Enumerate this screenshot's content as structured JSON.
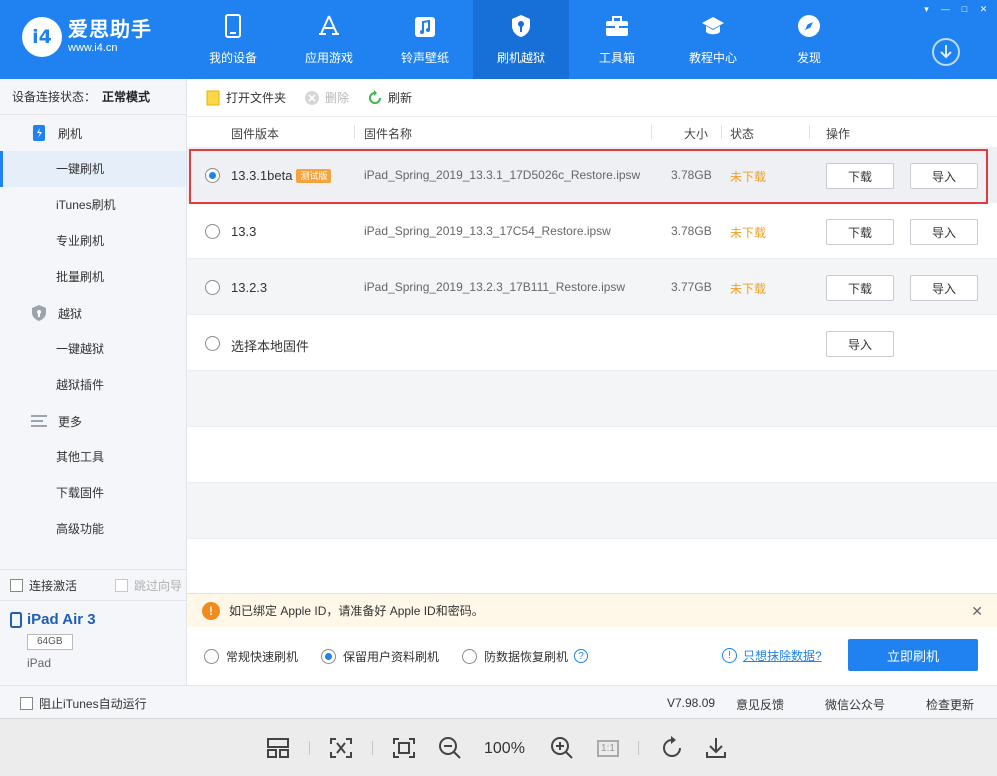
{
  "window_controls": [
    "▾",
    "—",
    "□",
    "✕"
  ],
  "logo": {
    "badge": "i4",
    "name": "爱思助手",
    "url": "www.i4.cn"
  },
  "nav": [
    {
      "label": "我的设备",
      "icon": "phone-icon"
    },
    {
      "label": "应用游戏",
      "icon": "app-store-icon"
    },
    {
      "label": "铃声壁纸",
      "icon": "music-note-icon"
    },
    {
      "label": "刷机越狱",
      "icon": "shield-key-icon",
      "active": true
    },
    {
      "label": "工具箱",
      "icon": "toolbox-icon"
    },
    {
      "label": "教程中心",
      "icon": "graduation-cap-icon"
    },
    {
      "label": "发现",
      "icon": "compass-icon"
    }
  ],
  "sidebar": {
    "status_label": "设备连接状态：",
    "status_value": "正常模式",
    "section_flash": "刷机",
    "flash_items": [
      "一键刷机",
      "iTunes刷机",
      "专业刷机",
      "批量刷机"
    ],
    "section_jailbreak": "越狱",
    "jailbreak_items": [
      "一键越狱",
      "越狱插件"
    ],
    "section_more": "更多",
    "more_items": [
      "其他工具",
      "下载固件",
      "高级功能"
    ],
    "auto_activate": "连接激活",
    "skip_guide": "跳过向导"
  },
  "device": {
    "name": "iPad Air 3",
    "capacity": "64GB",
    "type": "iPad"
  },
  "toolbar": {
    "open_folder": "打开文件夹",
    "delete": "删除",
    "refresh": "刷新"
  },
  "table": {
    "headers": {
      "version": "固件版本",
      "name": "固件名称",
      "size": "大小",
      "status": "状态",
      "action": "操作"
    },
    "rows": [
      {
        "version": "13.3.1beta",
        "badge": "测试版",
        "name": "iPad_Spring_2019_13.3.1_17D5026c_Restore.ipsw",
        "size": "3.78GB",
        "status": "未下载",
        "download": "下载",
        "import": "导入",
        "selected": true
      },
      {
        "version": "13.3",
        "name": "iPad_Spring_2019_13.3_17C54_Restore.ipsw",
        "size": "3.78GB",
        "status": "未下载",
        "download": "下载",
        "import": "导入"
      },
      {
        "version": "13.2.3",
        "name": "iPad_Spring_2019_13.2.3_17B111_Restore.ipsw",
        "size": "3.77GB",
        "status": "未下载",
        "download": "下载",
        "import": "导入"
      }
    ],
    "local": {
      "label": "选择本地固件",
      "import": "导入"
    }
  },
  "notice": {
    "text": "如已绑定 Apple ID，请准备好 Apple ID和密码。",
    "close": "✕"
  },
  "flash_options": {
    "options": [
      "常规快速刷机",
      "保留用户资料刷机",
      "防数据恢复刷机"
    ],
    "selected_index": 1,
    "erase_link": "只想抹除数据?",
    "flash_button": "立即刷机"
  },
  "statusbar": {
    "block_itunes": "阻止iTunes自动运行",
    "version": "V7.98.09",
    "feedback": "意见反馈",
    "wechat": "微信公众号",
    "update": "检查更新"
  },
  "viewer": {
    "zoom": "100%",
    "actual_size": "1:1"
  },
  "colors": {
    "brand": "#1f82f0",
    "warning": "#f0a020",
    "highlight": "#e23b3b"
  }
}
